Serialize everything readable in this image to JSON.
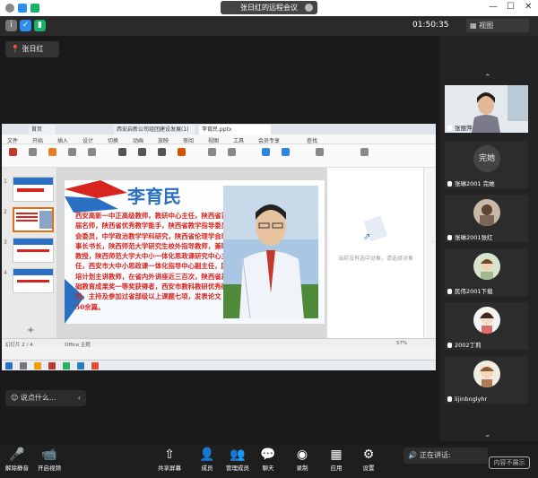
{
  "window": {
    "title": "张日红的远程会议"
  },
  "topbar": {
    "time": "01:50:35",
    "view_label": "视图"
  },
  "speaker": {
    "label": "张日红"
  },
  "shared_screen": {
    "tabs": [
      "首页",
      "西安启新公司组团建设发展(1)",
      "李育民.pptx"
    ],
    "menu": [
      "文件",
      "开始",
      "插入",
      "设计",
      "切换",
      "动画",
      "放映",
      "审阅",
      "视图",
      "工具",
      "会员专享",
      "查找"
    ],
    "slide": {
      "name": "李育民",
      "bio": "西安高新一中正高级教师，教研中心主任，陕西省首届名师，陕西省优秀教学能手，陕西省教学指导委员会委员，中学政治教学学科研究，陕西省伦理学会理事长书长，陕西师范大学研究生校外指导教师，兼职教授，陕西师范大学大中小一体化思政课研究中心主任，西安市大中小思政课一体化指导中心副主任，国培计划主讲教师，在省内外讲座近三百次，陕西省基础教育成果奖一等奖获得者，西安市教科教研优秀研究，主持及参加过省部级以上课题七项，发表论文50余篇。"
    },
    "thumbnails": [
      "1",
      "2",
      "3",
      "4"
    ],
    "right_pane_caption": "当前没有选中对象，请选择对象",
    "statusbar": {
      "left": "幻灯片 2 / 4",
      "mid": "Office 主题",
      "zoom": "57%"
    }
  },
  "participants": [
    {
      "name": "张丽萍"
    },
    {
      "name": "完她",
      "label": "张琳2001 完她"
    },
    {
      "name": "张琳2001张红",
      "label": "张琳2001张红"
    },
    {
      "name": "民伟2001下载",
      "label": "民伟2001下载"
    },
    {
      "name": "2002丁莉",
      "label": "2002丁莉"
    },
    {
      "name": "lijinbnglyhr",
      "label": "lijinbnglyhr"
    }
  ],
  "chat": {
    "placeholder": "说点什么..."
  },
  "toolbar": {
    "mute": "解除静音",
    "video": "开启视频",
    "share": "共享屏幕",
    "members": "成员",
    "manage": "管理成员",
    "chat": "聊天",
    "record": "录制",
    "apps": "应用",
    "settings": "设置"
  },
  "notification": "正在讲话:",
  "record_badge": "内容不展示"
}
